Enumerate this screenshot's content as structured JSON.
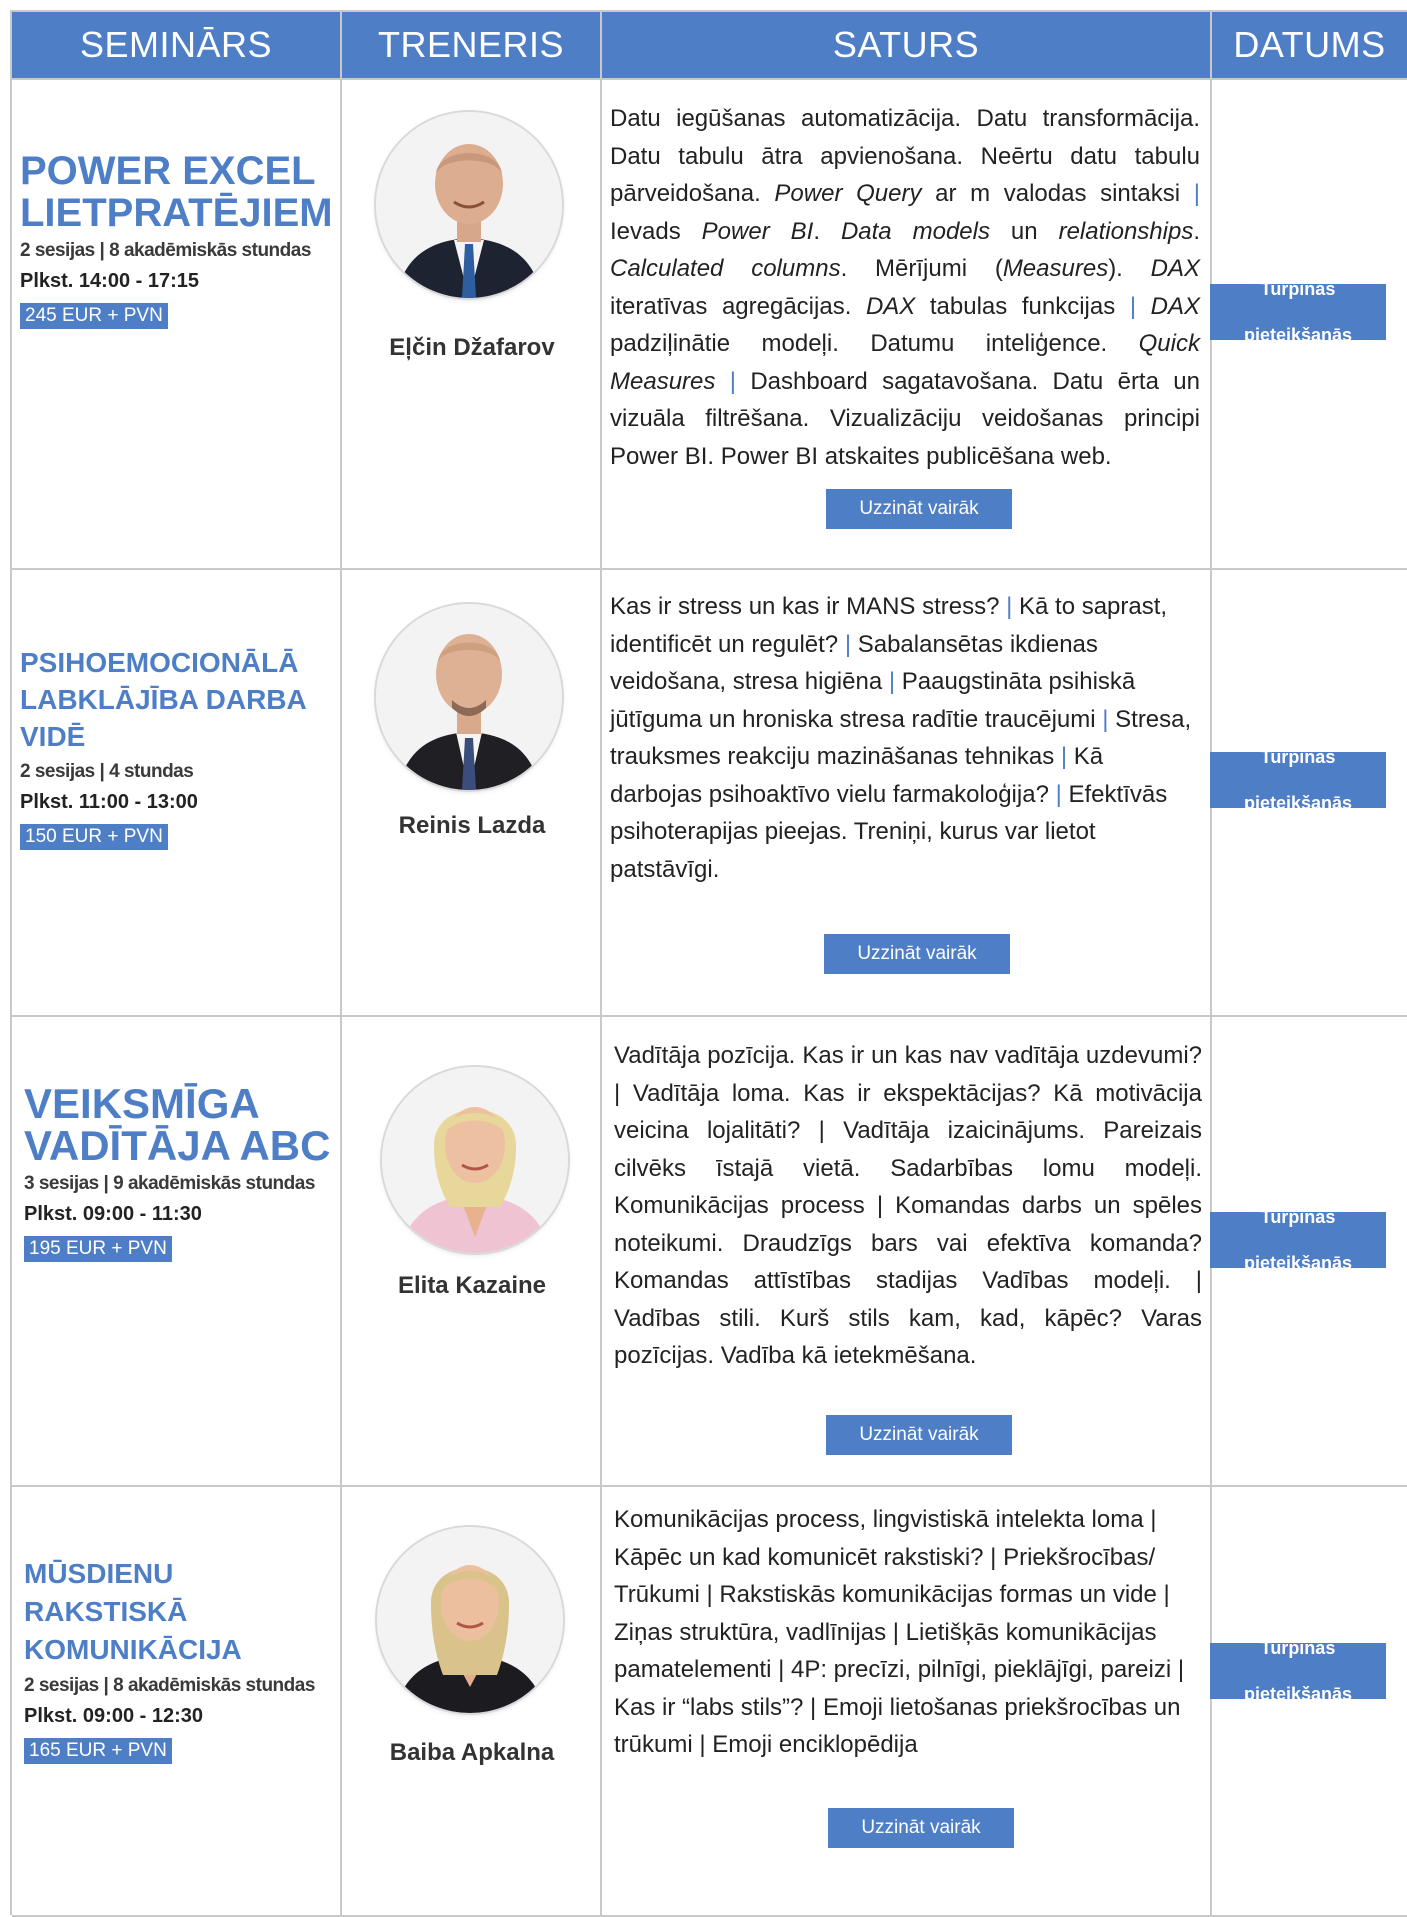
{
  "header": {
    "col_seminar": "SEMINĀRS",
    "col_trainer": "TRENERIS",
    "col_content": "SATURS",
    "col_date": "DATUMS"
  },
  "rows": [
    {
      "title_line1": "POWER EXCEL",
      "title_line2": "LIETPRATĒJIEM",
      "meta": "2 sesijas | 8 akadēmiskās stundas",
      "time": "Plkst. 14:00 - 17:15",
      "price": "245 EUR + PVN",
      "trainer": "Eļčin Džafarov",
      "content_parts": [
        "Datu iegūšanas automatizācija. Datu transformācija. Datu tabulu ātra apvienošana. Neērtu datu tabulu pārveidošana. ",
        "Power Query",
        " ar m valodas sintaksi ",
        "|",
        " Ievads ",
        "Power BI",
        ". ",
        "Data models",
        " un ",
        "relationships",
        ". ",
        "Calculated columns",
        ". Mērījumi (",
        "Measures",
        "). ",
        "DAX",
        " iteratīvas agregācijas. ",
        "DAX",
        " tabulas funkcijas ",
        "|",
        " ",
        "DAX",
        " padziļinātie modeļi. Datumu inteliģence. ",
        "Quick Measures",
        " ",
        "|",
        " Dashboard sagatavošana. Datu ērta un vizuāla filtrēšana. Vizualizāciju veidošanas principi Power BI. Power BI atskaites publicēšana web."
      ],
      "more": "Uzzināt vairāk",
      "date_line1": "Turpinās",
      "date_line2": "pieteikšanās"
    },
    {
      "title_line1": "PSIHOEMOCIONĀLĀ",
      "title_line2": "LABKLĀJĪBA DARBA",
      "title_line3": "VIDĒ",
      "meta": "2 sesijas | 4 stundas",
      "time": "Plkst. 11:00 - 13:00",
      "price": "150 EUR + PVN",
      "trainer": "Reinis Lazda",
      "content_parts": [
        "Kas ir stress un kas ir MANS stress? ",
        "|",
        " Kā to saprast, identificēt un regulēt? ",
        "|",
        " Sabalansētas ikdienas veidošana, stresa higiēna ",
        "|",
        " Paaugstināta psihiskā jūtīguma un hroniska stresa radītie traucējumi ",
        "|",
        " Stresa, trauksmes reakciju mazināšanas tehnikas ",
        "|",
        " Kā darbojas psihoaktīvo vielu farmakoloģija? ",
        "|",
        " Efektīvās psihoterapijas pieejas. Treniņi, kurus var lietot patstāvīgi."
      ],
      "more": "Uzzināt vairāk",
      "date_line1": "Turpinās",
      "date_line2": "pieteikšanās"
    },
    {
      "title_line1": "VEIKSMĪGA",
      "title_line2": "VADĪTĀJA ABC",
      "meta": "3 sesijas | 9 akadēmiskās stundas",
      "time": "Plkst. 09:00 - 11:30",
      "price": "195 EUR + PVN",
      "trainer": "Elita Kazaine",
      "content": "Vadītāja pozīcija. Kas ir un kas nav vadītāja uzdevumi? | Vadītāja loma. Kas ir ekspektācijas? Kā motivācija veicina lojalitāti? | Vadītāja izaicinājums. Pareizais cilvēks īstajā vietā. Sadarbības lomu modeļi. Komunikācijas process | Komandas darbs un spēles noteikumi. Draudzīgs bars vai efektīva komanda? Komandas attīstības stadijas Vadības modeļi. | Vadības stili. Kurš stils kam, kad, kāpēc? Varas pozīcijas. Vadība kā ietekmēšana.",
      "more": "Uzzināt vairāk",
      "date_line1": "Turpinās",
      "date_line2": "pieteikšanās"
    },
    {
      "title_line1": "MŪSDIENU RAKSTISKĀ",
      "title_line2": "KOMUNIKĀCIJA",
      "meta": "2 sesijas | 8 akadēmiskās stundas",
      "time": "Plkst. 09:00 - 12:30",
      "price": "165 EUR + PVN",
      "trainer": "Baiba Apkalna",
      "content": "Komunikācijas process, lingvistiskā intelekta loma | Kāpēc un kad komunicēt rakstiski? | Priekšrocības/ Trūkumi | Rakstiskās komunikācijas formas un vide | Ziņas struktūra, vadlīnijas | Lietišķās komunikācijas pamatelementi | 4P: precīzi, pilnīgi, pieklājīgi, pareizi | Kas ir “labs stils”? | Emoji lietošanas priekšrocības un trūkumi | Emoji enciklopēdija",
      "more": "Uzzināt vairāk",
      "date_line1": "Turpinās",
      "date_line2": "pieteikšanās"
    }
  ],
  "colors": {
    "accent": "#4e7fc6",
    "border": "#c9c9c9"
  },
  "icons": [
    "trainer-photo-male",
    "trainer-photo-male",
    "trainer-photo-female",
    "trainer-photo-female"
  ]
}
